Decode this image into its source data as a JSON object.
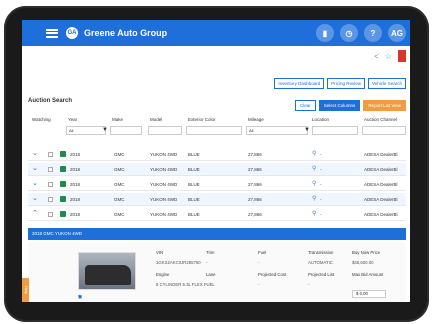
{
  "header": {
    "logo_text": "GA",
    "app_title": "Greene Auto Group",
    "icons": [
      "cart-icon",
      "clock-icon",
      "help-icon",
      "user-icon"
    ],
    "user_initials": "AG"
  },
  "links": [
    "Inventory Dashboard",
    "Pricing Review",
    "Vehicle Search"
  ],
  "section": {
    "title": "Auction Search",
    "clear_label": "Clear",
    "select_columns_label": "Select Columns",
    "report_label": "Report List View"
  },
  "columns": [
    "Watching",
    "Year",
    "Make",
    "Model",
    "Exterior Color",
    "Mileage",
    "Location",
    "Auction Channel"
  ],
  "filters": {
    "year": "All",
    "mileage": "All"
  },
  "rows": [
    {
      "year": "2018",
      "make": "GMC",
      "model": "YUKON 4WD",
      "color": "BLUE",
      "mileage": "27,866",
      "location": "-",
      "channel": "ADESA DealerBl"
    },
    {
      "year": "2018",
      "make": "GMC",
      "model": "YUKON 4WD",
      "color": "BLUE",
      "mileage": "27,866",
      "location": "-",
      "channel": "ADESA DealerBl"
    },
    {
      "year": "2018",
      "make": "GMC",
      "model": "YUKON 4WD",
      "color": "BLUE",
      "mileage": "27,866",
      "location": "-",
      "channel": "ADESA DealerBl"
    },
    {
      "year": "2018",
      "make": "GMC",
      "model": "YUKON 4WD",
      "color": "BLUE",
      "mileage": "27,866",
      "location": "-",
      "channel": "ADESA DealerBl"
    },
    {
      "year": "2018",
      "make": "GMC",
      "model": "YUKON 4WD",
      "color": "BLUE",
      "mileage": "27,866",
      "location": "-",
      "channel": "ADESA DealerBl"
    }
  ],
  "selected_title": "2018 GMC YUKON 4WD",
  "detail": {
    "vin_label": "VIN",
    "vin": "1GKS2AKC0JR285760",
    "trim_label": "Trim",
    "trim": "-",
    "fuel_label": "Fuel",
    "fuel": "-",
    "transmission_label": "Transmission",
    "transmission": "AUTOMATIC",
    "buy_now_label": "Buy Now Price",
    "buy_now": "$48,600.00",
    "engine_label": "Engine",
    "engine": "8 CYLINDER 5.3L FLEX FUEL",
    "lane_label": "Lane",
    "lane": "-",
    "projected_cost_label": "Projected Cost",
    "projected_cost": "-",
    "projected_list_label": "Projected List",
    "projected_list": "-",
    "max_bid_label": "Max Bid Amount",
    "max_bid": "$ 0.00"
  },
  "side_tab_label": "Help",
  "colors": {
    "primary": "#1e6fd9",
    "accent": "#f39c3e",
    "danger": "#d9352b"
  }
}
